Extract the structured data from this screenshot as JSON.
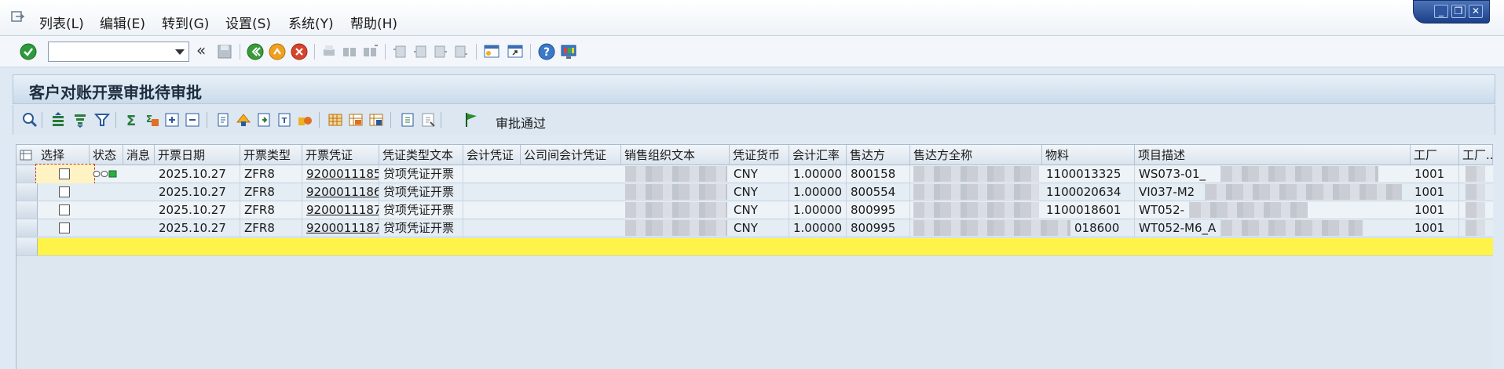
{
  "menu": {
    "items": [
      "列表(L)",
      "编辑(E)",
      "转到(G)",
      "设置(S)",
      "系统(Y)",
      "帮助(H)"
    ]
  },
  "window_controls": {
    "minimize": "_",
    "restore": "❐",
    "close": "✕"
  },
  "toolbar": {
    "command_field_value": "",
    "back_chevron": "«"
  },
  "title": "客户对账开票审批待审批",
  "alv_toolbar": {
    "approve_label": "审批通过"
  },
  "grid": {
    "columns": [
      "选择",
      "状态",
      "消息",
      "开票日期",
      "开票类型",
      "开票凭证",
      "凭证类型文本",
      "会计凭证",
      "公司间会计凭证",
      "销售组织文本",
      "凭证货币",
      "会计汇率",
      "售达方",
      "售达方全称",
      "物料",
      "项目描述",
      "工厂",
      "工厂..."
    ],
    "rows": [
      {
        "date": "2025.10.27",
        "type": "ZFR8",
        "doc": "9200011185",
        "doc_type_text": "贷项凭证开票",
        "currency": "CNY",
        "rate": "1.00000",
        "sold_to": "800158",
        "material": "1100013325",
        "desc": "WS073-01_",
        "plant": "1001"
      },
      {
        "date": "2025.10.27",
        "type": "ZFR8",
        "doc": "9200011186",
        "doc_type_text": "贷项凭证开票",
        "currency": "CNY",
        "rate": "1.00000",
        "sold_to": "800554",
        "material": "1100020634",
        "desc": "VI037-M2",
        "plant": "1001"
      },
      {
        "date": "2025.10.27",
        "type": "ZFR8",
        "doc": "9200011187",
        "doc_type_text": "贷项凭证开票",
        "currency": "CNY",
        "rate": "1.00000",
        "sold_to": "800995",
        "material": "1100018601",
        "desc": "WT052-",
        "plant": "1001"
      },
      {
        "date": "2025.10.27",
        "type": "ZFR8",
        "doc": "9200011187",
        "doc_type_text": "贷项凭证开票",
        "currency": "CNY",
        "rate": "1.00000",
        "sold_to": "800995",
        "material": "018600",
        "desc": "WT052-M6_A",
        "plant": "1001"
      }
    ]
  },
  "colors": {
    "accent_blue": "#1b3f88",
    "highlight_yellow": "#fff34a",
    "approve_green": "#2e8b2e"
  },
  "icons": [
    "enter-icon",
    "save-icon",
    "back-icon",
    "exit-icon",
    "cancel-icon",
    "print-icon",
    "find-icon",
    "find-next-icon",
    "first-page-icon",
    "prev-page-icon",
    "next-page-icon",
    "last-page-icon",
    "new-session-icon",
    "shortcut-icon",
    "help-icon",
    "customize-layout-icon"
  ]
}
